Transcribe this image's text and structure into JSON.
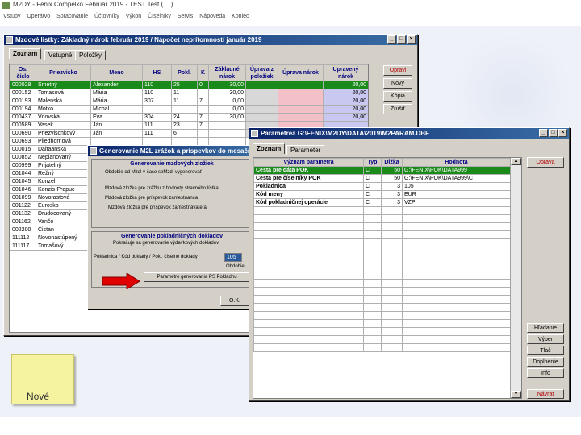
{
  "app": {
    "title": "M2DY - Fenix Compelko Február 2019 - TEST Test (TT)",
    "menu": [
      "Vstupy",
      "Operátvo",
      "Spracovanie",
      "Účtovníky",
      "Výkon",
      "Číselníky",
      "Servis",
      "Nápoveda",
      "Koniec"
    ]
  },
  "main_window": {
    "title": "Mzdové listky: Základný nárok február 2019 / Nápočet neprítomností január 2019",
    "tabs": [
      "Zoznam",
      "Vstupné",
      "Položky"
    ],
    "columns": [
      "Os. číslo",
      "Priezvisko",
      "Meno",
      "HS",
      "Pokl.",
      "K",
      "Základné nárok",
      "Úprava z položiek",
      "Úprava nárok",
      "Upravený nárok"
    ],
    "rows": [
      {
        "id": "000028",
        "surname": "Smetný",
        "name": "Alexander",
        "hs": "110",
        "pokl": "25",
        "k": "0",
        "zaklad": "30,00",
        "upraveny": "20,00"
      },
      {
        "id": "000152",
        "surname": "Tomasová",
        "name": "Mária",
        "hs": "110",
        "pokl": "11",
        "k": "",
        "zaklad": "30,00",
        "upraveny": "20,00"
      },
      {
        "id": "000193",
        "surname": "Malenská",
        "name": "Mária",
        "hs": "307",
        "pokl": "11",
        "k": "7",
        "zaklad": "0,00",
        "upraveny": "20,00"
      },
      {
        "id": "000194",
        "surname": "Motko",
        "name": "Michal",
        "hs": "",
        "pokl": "",
        "k": "",
        "zaklad": "0,00",
        "upraveny": "20,00"
      },
      {
        "id": "000437",
        "surname": "Vdovská",
        "name": "Eva",
        "hs": "304",
        "pokl": "24",
        "k": "7",
        "zaklad": "30,00",
        "upraveny": "20,00"
      },
      {
        "id": "000589",
        "surname": "Vasek",
        "name": "Ján",
        "hs": "111",
        "pokl": "23",
        "k": "7",
        "zaklad": "",
        "upraveny": ""
      },
      {
        "id": "000690",
        "surname": "Priezvischkový",
        "name": "Ján",
        "hs": "111",
        "pokl": "6",
        "k": "",
        "zaklad": "",
        "upraveny": ""
      },
      {
        "id": "000693",
        "surname": "Pliedhornová",
        "name": "",
        "hs": "",
        "pokl": "",
        "k": "",
        "zaklad": "",
        "upraveny": ""
      },
      {
        "id": "000015",
        "surname": "Daltaanská",
        "name": "",
        "hs": "",
        "pokl": "",
        "k": "",
        "zaklad": "",
        "upraveny": ""
      },
      {
        "id": "000852",
        "surname": "Neplanovaný",
        "name": "",
        "hs": "",
        "pokl": "",
        "k": "",
        "zaklad": "",
        "upraveny": ""
      },
      {
        "id": "000999",
        "surname": "Prijatelný",
        "name": "",
        "hs": "",
        "pokl": "",
        "k": "",
        "zaklad": "",
        "upraveny": ""
      },
      {
        "id": "001044",
        "surname": "Režný",
        "name": "",
        "hs": "",
        "pokl": "",
        "k": "",
        "zaklad": "",
        "upraveny": ""
      },
      {
        "id": "001045",
        "surname": "Konzel",
        "name": "",
        "hs": "",
        "pokl": "",
        "k": "",
        "zaklad": "",
        "upraveny": ""
      },
      {
        "id": "001046",
        "surname": "Konzis-Prapuc",
        "name": "",
        "hs": "",
        "pokl": "",
        "k": "",
        "zaklad": "",
        "upraveny": ""
      },
      {
        "id": "001099",
        "surname": "Novorastová",
        "name": "",
        "hs": "",
        "pokl": "",
        "k": "",
        "zaklad": "",
        "upraveny": ""
      },
      {
        "id": "001122",
        "surname": "Eurosko",
        "name": "",
        "hs": "",
        "pokl": "",
        "k": "",
        "zaklad": "",
        "upraveny": ""
      },
      {
        "id": "001132",
        "surname": "Drudocovaný",
        "name": "",
        "hs": "",
        "pokl": "",
        "k": "",
        "zaklad": "",
        "upraveny": ""
      },
      {
        "id": "001162",
        "surname": "Vančo",
        "name": "",
        "hs": "",
        "pokl": "",
        "k": "",
        "zaklad": "",
        "upraveny": ""
      },
      {
        "id": "002200",
        "surname": "Čistan",
        "name": "",
        "hs": "",
        "pokl": "",
        "k": "",
        "zaklad": "",
        "upraveny": ""
      },
      {
        "id": "111112",
        "surname": "Novonastúpený",
        "name": "",
        "hs": "",
        "pokl": "",
        "k": "",
        "zaklad": "",
        "upraveny": ""
      },
      {
        "id": "111117",
        "surname": "Tomašový",
        "name": "",
        "hs": "",
        "pokl": "",
        "k": "",
        "zaklad": "",
        "upraveny": ""
      }
    ],
    "side_buttons": [
      "Opravi",
      "Nový",
      "Kópia",
      "Zrušiť"
    ]
  },
  "gen_dialog": {
    "title": "Generovanie M2L zrážok a príspevkov do mesačného...",
    "section1_title": "Generovanie mzdových zložiek",
    "section1_lines": [
      "Obdobie od Mzdl v čase spMzdl vygenerovať",
      "Mzdová zložka pre zrážku z hodnoty stravného lístka",
      "Mzdová zložka pre príspevok zamestnanca",
      "Mzdová zložka pre príspevok zamestnávateľa"
    ],
    "section2_title": "Generovanie pokladničných dokladov",
    "section2_line": "Pokračuje sa generovanie výdavkových dokladov",
    "pokl_label": "Pokladnica / Kód doklady / Pokl. číselné doklady",
    "pokl_value": "105",
    "obdobie_label": "Obdobie",
    "parameter_button": "Parametre generovania PS Pokladnu",
    "ok_button": "O.K."
  },
  "param_window": {
    "title": "Parametrea G:\\FENIX\\M2DY\\DATA\\2019\\M2PARAM.DBF",
    "tabs": [
      "Zoznam",
      "Parameter"
    ],
    "columns": [
      "Význam parametra",
      "Typ",
      "Dĺžka",
      "Hodnota"
    ],
    "rows": [
      {
        "name": "Cesta pre dáta POK",
        "typ": "C",
        "dlzka": "50",
        "hodnota": "G:\\FENIX\\POK\\DATA999"
      },
      {
        "name": "Cesta pre číselníky POK",
        "typ": "C",
        "dlzka": "50",
        "hodnota": "G:\\FENIX\\POK\\DATA999\\C"
      },
      {
        "name": "Pokladnica",
        "typ": "C",
        "dlzka": "3",
        "hodnota": "105"
      },
      {
        "name": "Kód meny",
        "typ": "C",
        "dlzka": "3",
        "hodnota": "EUR"
      },
      {
        "name": "Kód pokladničnej operácie",
        "typ": "C",
        "dlzka": "3",
        "hodnota": "VZP"
      }
    ],
    "side_buttons_top": [
      "Oprava"
    ],
    "side_buttons_bottom": [
      "Hľadanie",
      "Výber",
      "Tlač",
      "Doplnenie",
      "Info"
    ],
    "exit_button": "Návrat"
  },
  "sticky_note": {
    "text": "Nové"
  },
  "colors": {
    "selected_row": "#1a8a1a",
    "title_blue": "#0a246a",
    "arrow": "#e00000",
    "sticky": "#f6f3a0"
  }
}
